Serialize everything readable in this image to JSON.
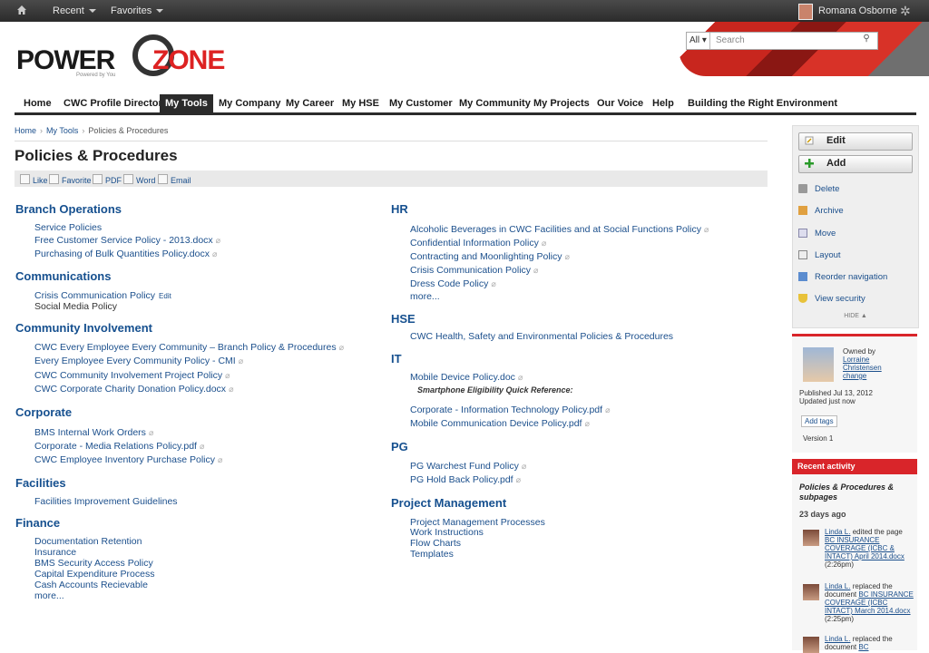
{
  "topbar": {
    "recent": "Recent",
    "favorites": "Favorites",
    "user": "Romana Osborne"
  },
  "logo": {
    "word1": "POWER",
    "word2": "ZONE",
    "tagline": "Powered by You"
  },
  "search": {
    "scope": "All",
    "placeholder": "Search"
  },
  "nav": [
    "Home",
    "CWC Profile Directory",
    "My Tools",
    "My Company",
    "My Career",
    "My HSE",
    "My Customer",
    "My Community",
    "My Projects",
    "Our Voice",
    "Help",
    "Building the Right Environment"
  ],
  "breadcrumb": [
    "Home",
    "My Tools",
    "Policies & Procedures"
  ],
  "page": {
    "title": "Policies & Procedures"
  },
  "toolbar": [
    "Like",
    "Favorite",
    "PDF",
    "Word",
    "Email"
  ],
  "left": {
    "branch": {
      "title": "Branch Operations",
      "items": [
        "Service Policies",
        "Free Customer Service Policy - 2013.docx",
        "Purchasing of Bulk Quantities Policy.docx"
      ]
    },
    "comms": {
      "title": "Communications",
      "items": [
        "Crisis Communication Policy",
        "Social Media Policy"
      ],
      "edit": "Edit"
    },
    "community": {
      "title": "Community Involvement",
      "items": [
        "CWC Every Employee Every Community – Branch Policy & Procedures",
        "Every Employee Every Community Policy - CMI",
        "CWC Community Involvement Project Policy",
        "CWC Corporate Charity Donation Policy.docx"
      ]
    },
    "corporate": {
      "title": "Corporate",
      "items": [
        "BMS Internal Work Orders",
        "Corporate - Media Relations Policy.pdf",
        "CWC Employee Inventory Purchase Policy"
      ]
    },
    "facilities": {
      "title": "Facilities",
      "items": [
        "Facilities Improvement Guidelines"
      ]
    },
    "finance": {
      "title": "Finance",
      "items": [
        "Documentation Retention",
        "Insurance",
        "BMS Security Access Policy",
        "Capital Expenditure Process",
        "Cash Accounts Recievable",
        "more..."
      ]
    }
  },
  "right": {
    "hr": {
      "title": "HR",
      "items": [
        "Alcoholic Beverages in CWC Facilities and at Social Functions Policy",
        "Confidential Information Policy",
        "Contracting and Moonlighting Policy",
        "Crisis Communication Policy",
        "Dress Code Policy",
        "more..."
      ]
    },
    "hse": {
      "title": "HSE",
      "items": [
        "CWC Health, Safety and Environmental Policies & Procedures"
      ]
    },
    "it": {
      "title": "IT",
      "items": [
        "Mobile Device Policy.doc",
        "Corporate - Information Technology Policy.pdf",
        "Mobile Communication Device Policy.pdf"
      ],
      "note": "Smartphone Eligibility Quick Reference:"
    },
    "pg": {
      "title": "PG",
      "items": [
        "PG Warchest Fund Policy",
        "PG Hold Back Policy.pdf"
      ]
    },
    "pm": {
      "title": "Project Management",
      "items": [
        "Project Management Processes",
        "Work Instructions",
        "Flow Charts",
        "Templates"
      ]
    }
  },
  "panel": {
    "edit": "Edit",
    "add": "Add",
    "actions": [
      "Delete",
      "Archive",
      "Move",
      "Layout",
      "Reorder navigation",
      "View security"
    ],
    "hide": "HIDE"
  },
  "owner": {
    "owned_by": "Owned by",
    "name1": "Lorraine",
    "name2": "Christensen",
    "change": "change",
    "published": "Published Jul 13, 2012",
    "updated": "Updated just now",
    "add_tags": "Add tags",
    "version": "Version 1"
  },
  "activity": {
    "header": "Recent activity",
    "title": "Policies & Procedures & subpages",
    "ago": "23 days ago",
    "entries": [
      {
        "user": "Linda L.",
        "action": "edited the page",
        "target": "BC INSURANCE COVERAGE (ICBC & INTACT) April 2014.docx",
        "time": "(2:26pm)"
      },
      {
        "user": "Linda L.",
        "action": "replaced the document",
        "target": "BC INSURANCE COVERAGE (ICBC INTACT) March 2014.docx",
        "time": "(2:25pm)"
      },
      {
        "user": "Linda L.",
        "action": "replaced the document",
        "target": "BC",
        "time": ""
      }
    ]
  }
}
